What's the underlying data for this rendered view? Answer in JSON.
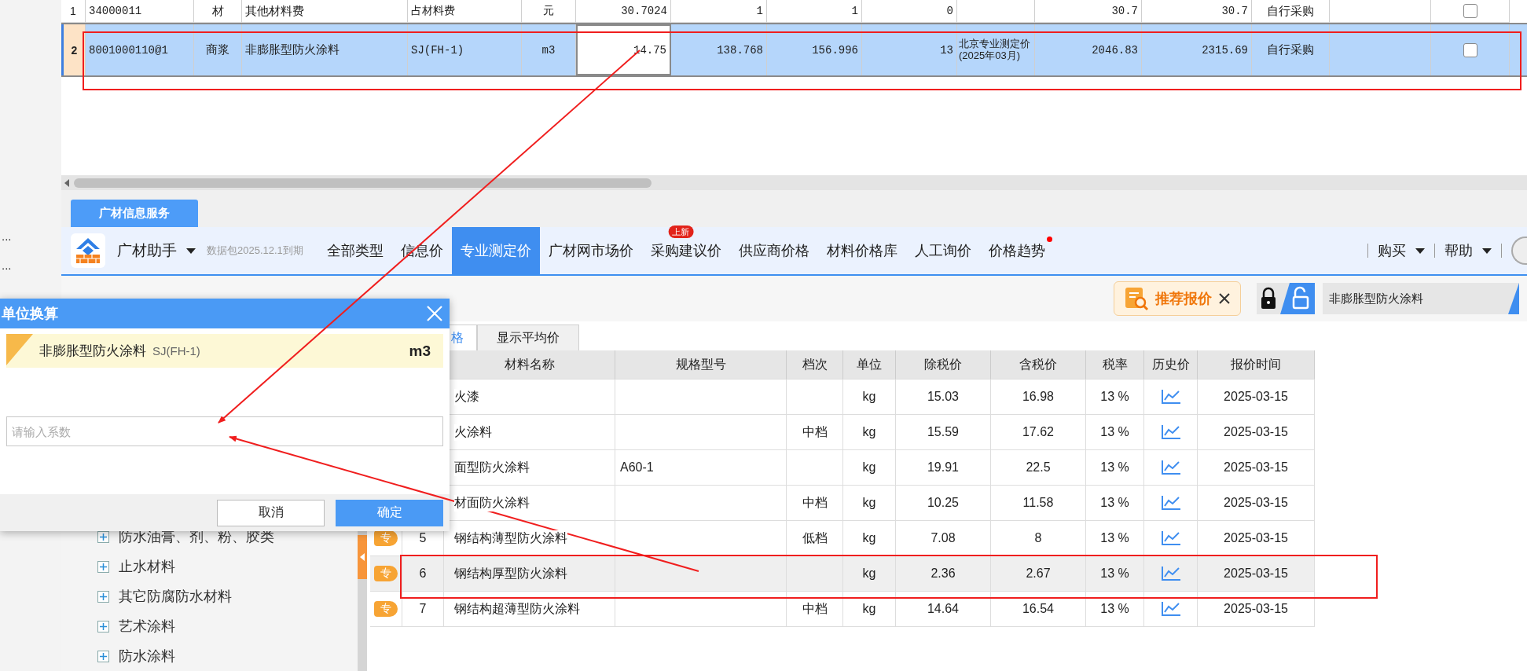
{
  "side_strip": {
    "items": [
      "...",
      "..."
    ]
  },
  "top_table": {
    "rows": [
      {
        "number": "1",
        "cells": [
          "34000011",
          "材",
          "其他材料费",
          "占材料费",
          "元",
          "30.7024",
          "1",
          "1",
          "0",
          null,
          "30.7",
          "30.7",
          "自行采购",
          null
        ],
        "selected": false,
        "editing": false,
        "checked": false
      },
      {
        "number": "2",
        "cells": [
          "8001000110@1",
          "商浆",
          "非膨胀型防火涂料",
          "SJ(FH-1)",
          "m3",
          "14.75",
          "138.768",
          "156.996",
          "13",
          "北京专业测定价(2025年03月)",
          "2046.83",
          "2315.69",
          "自行采购",
          null
        ],
        "selected": true,
        "editing": true,
        "checked": false
      }
    ]
  },
  "service_tab": "广材信息服务",
  "toolbar": {
    "app_name": "广材助手",
    "data_note": "数据包2025.12.1到期",
    "nav": [
      {
        "label": "全部类型",
        "selected": false,
        "notify": false
      },
      {
        "label": "信息价",
        "selected": false,
        "notify": false
      },
      {
        "label": "专业测定价",
        "selected": true,
        "notify": false
      },
      {
        "label": "广材网市场价",
        "selected": false,
        "notify": false
      },
      {
        "label": "采购建议价",
        "selected": false,
        "notify": false,
        "badge": "上新"
      },
      {
        "label": "供应商价格",
        "selected": false,
        "notify": false
      },
      {
        "label": "材料价格库",
        "selected": false,
        "notify": false
      },
      {
        "label": "人工询价",
        "selected": false,
        "notify": false
      },
      {
        "label": "价格趋势",
        "selected": false,
        "notify": true
      }
    ],
    "menus": [
      "购买",
      "帮助"
    ]
  },
  "filter_bar": {
    "recommend_button": "推荐报价",
    "search_value": "非膨胀型防火涂料"
  },
  "tree": {
    "items": [
      "防水油膏、剂、粉、胶类",
      "止水材料",
      "其它防腐防水材料",
      "艺术涂料",
      "防水涂料"
    ]
  },
  "price_tabs": [
    {
      "label": "格",
      "selected": true
    },
    {
      "label": "显示平均价",
      "selected": false
    }
  ],
  "price_table": {
    "columns": [
      "材料名称",
      "规格型号",
      "档次",
      "单位",
      "除税价",
      "含税价",
      "税率",
      "历史价",
      "报价时间"
    ],
    "rows": [
      {
        "name": "火漆",
        "unit": "kg",
        "pretax": "15.03",
        "taxed": "16.98",
        "rate": "13 %",
        "time": "2025-03-15",
        "selected": false
      },
      {
        "name": "火涂料",
        "grade": "中档",
        "unit": "kg",
        "pretax": "15.59",
        "taxed": "17.62",
        "rate": "13 %",
        "time": "2025-03-15",
        "selected": false
      },
      {
        "name": "面型防火涂料",
        "spec": "A60-1",
        "unit": "kg",
        "pretax": "19.91",
        "taxed": "22.5",
        "rate": "13 %",
        "time": "2025-03-15",
        "selected": false
      },
      {
        "name": "材面防火涂料",
        "grade": "中档",
        "unit": "kg",
        "pretax": "10.25",
        "taxed": "11.58",
        "rate": "13 %",
        "time": "2025-03-15",
        "selected": false
      },
      {
        "badge": "专",
        "num": "5",
        "name": "钢结构薄型防火涂料",
        "grade": "低档",
        "unit": "kg",
        "pretax": "7.08",
        "taxed": "8",
        "rate": "13 %",
        "time": "2025-03-15",
        "selected": false
      },
      {
        "badge": "专",
        "num": "6",
        "name": "钢结构厚型防火涂料",
        "unit": "kg",
        "pretax": "2.36",
        "taxed": "2.67",
        "rate": "13 %",
        "time": "2025-03-15",
        "selected": true
      },
      {
        "badge": "专",
        "num": "7",
        "name": "钢结构超薄型防火涂料",
        "grade": "中档",
        "unit": "kg",
        "pretax": "14.64",
        "taxed": "16.54",
        "rate": "13 %",
        "time": "2025-03-15",
        "selected": false
      }
    ]
  },
  "dialog": {
    "title": "单位换算",
    "material": "非膨胀型防火涂料",
    "spec": "SJ(FH-1)",
    "unit": "m3",
    "placeholder": "请输入系数",
    "buttons": [
      {
        "label": "取消",
        "kind": "secondary"
      },
      {
        "label": "确定",
        "kind": "primary"
      }
    ]
  }
}
